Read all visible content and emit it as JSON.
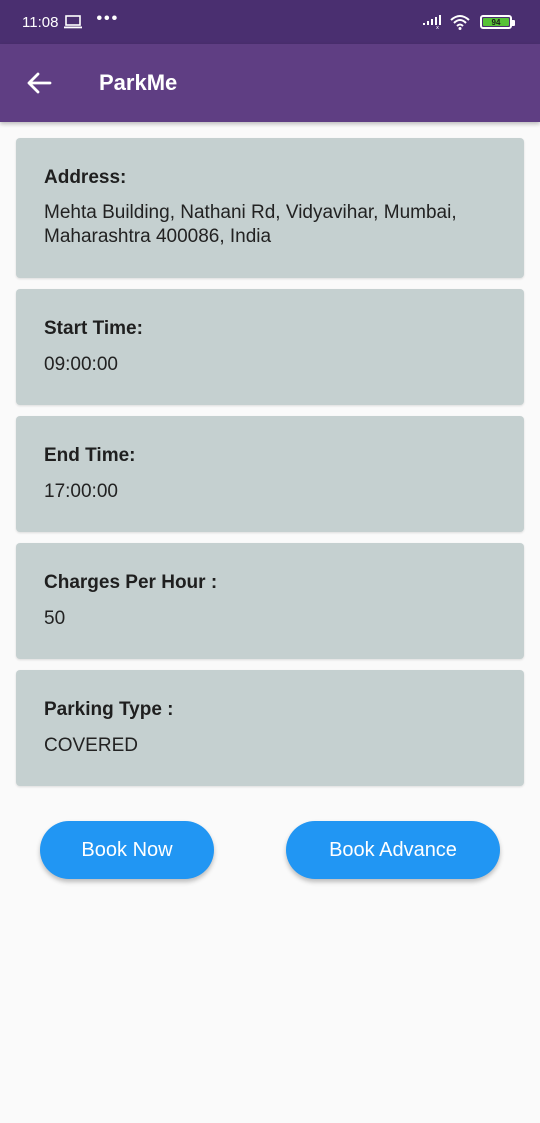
{
  "status_bar": {
    "time": "11:08",
    "dots": "•••",
    "battery": "94"
  },
  "app_bar": {
    "title": "ParkMe"
  },
  "details": {
    "address_label": "Address:",
    "address_value": "Mehta Building, Nathani Rd, Vidyavihar, Mumbai, Maharashtra 400086, India",
    "start_time_label": "Start Time:",
    "start_time_value": "09:00:00",
    "end_time_label": "End Time:",
    "end_time_value": "17:00:00",
    "charges_label": "Charges Per Hour :",
    "charges_value": "50",
    "parking_type_label": "Parking Type :",
    "parking_type_value": "COVERED"
  },
  "actions": {
    "book_now": "Book Now",
    "book_advance": "Book Advance"
  },
  "colors": {
    "status_bar": "#4a2f70",
    "app_bar": "#5f3e83",
    "card": "#c5d0d0",
    "button": "#2196f3",
    "background": "#fafafa"
  }
}
